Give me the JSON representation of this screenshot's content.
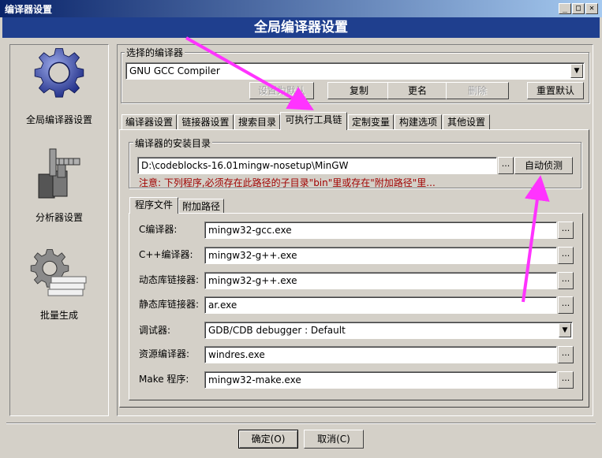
{
  "window": {
    "title": "编译器设置",
    "banner": "全局编译器设置"
  },
  "sidebar": {
    "items": [
      {
        "label": "全局编译器设置",
        "icon": "gear-icon"
      },
      {
        "label": "分析器设置",
        "icon": "caliper-icon"
      },
      {
        "label": "批量生成",
        "icon": "batch-gear-icon"
      }
    ]
  },
  "compiler": {
    "group_label": "选择的编译器",
    "selected": "GNU GCC Compiler",
    "buttons": {
      "set_default": "设置为默认",
      "copy": "复制",
      "rename": "更名",
      "delete": "删除",
      "reset": "重置默认"
    }
  },
  "tabs": [
    "编译器设置",
    "链接器设置",
    "搜索目录",
    "可执行工具链",
    "定制变量",
    "构建选项",
    "其他设置"
  ],
  "install": {
    "group_label": "编译器的安装目录",
    "path": "D:\\codeblocks-16.01mingw-nosetup\\MinGW",
    "browse": "...",
    "autodetect": "自动侦测",
    "note": "注意: 下列程序,必须存在此路径的子目录\"bin\"里或存在\"附加路径\"里..."
  },
  "subtabs": [
    "程序文件",
    "附加路径"
  ],
  "programs": [
    {
      "label": "C编译器:",
      "value": "mingw32-gcc.exe"
    },
    {
      "label": "C++编译器:",
      "value": "mingw32-g++.exe"
    },
    {
      "label": "动态库链接器:",
      "value": "mingw32-g++.exe"
    },
    {
      "label": "静态库链接器:",
      "value": "ar.exe"
    },
    {
      "label": "调试器:",
      "value": "GDB/CDB debugger : Default"
    },
    {
      "label": "资源编译器:",
      "value": "windres.exe"
    },
    {
      "label": "Make 程序:",
      "value": "mingw32-make.exe"
    }
  ],
  "browse_label": "...",
  "footer": {
    "ok": "确定(O)",
    "cancel": "取消(C)"
  },
  "colors": {
    "annotation_arrow": "#ff33ff",
    "banner": "#1f3f8e",
    "note_text": "#a00000"
  }
}
